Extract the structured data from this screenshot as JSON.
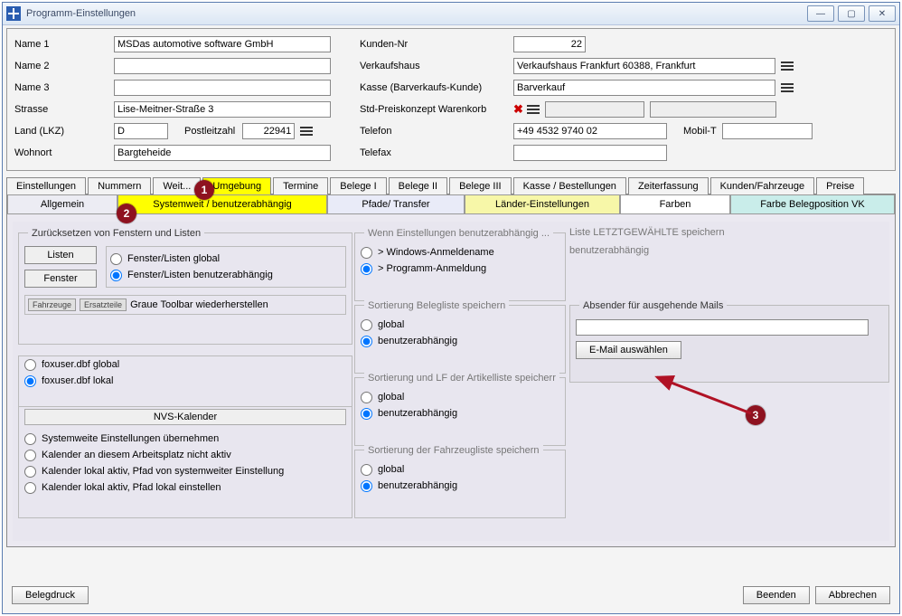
{
  "window": {
    "title": "Programm-Einstellungen"
  },
  "top": {
    "labels": {
      "name1": "Name 1",
      "name2": "Name 2",
      "name3": "Name 3",
      "street": "Strasse",
      "land": "Land (LKZ)",
      "plz": "Postleitzahl",
      "ort": "Wohnort",
      "kundennr": "Kunden-Nr",
      "verkaufshaus": "Verkaufshaus",
      "kasse": "Kasse (Barverkaufs-Kunde)",
      "pk": "Std-Preiskonzept Warenkorb",
      "tel": "Telefon",
      "mob": "Mobil-T",
      "fax": "Telefax"
    },
    "values": {
      "name1": "MSDas automotive software GmbH",
      "name2": "",
      "name3": "",
      "street": "Lise-Meitner-Straße 3",
      "land": "D",
      "plz": "22941",
      "ort": "Bargteheide",
      "kundennr": "22",
      "verkaufshaus": "Verkaufshaus Frankfurt 60388, Frankfurt",
      "kasse": "Barverkauf",
      "tel": "+49 4532 9740 02",
      "mob": "",
      "fax": ""
    }
  },
  "tabs1": [
    "Einstellungen",
    "Nummern",
    "Weit...",
    "Umgebung",
    "Termine",
    "Belege I",
    "Belege II",
    "Belege III",
    "Kasse / Bestellungen",
    "Zeiterfassung",
    "Kunden/Fahrzeuge",
    "Preise"
  ],
  "tabs1_selected": 3,
  "tabs2": [
    "Allgemein",
    "Systemweit / benutzerabhängig",
    "Pfade/ Transfer",
    "Länder-Einstellungen",
    "Farben",
    "Farbe Belegposition VK"
  ],
  "tabs2_selected": 1,
  "pane": {
    "g_reset_title": "Zurücksetzen von Fenstern und Listen",
    "btn_listen": "Listen",
    "btn_fenster": "Fenster",
    "opt_fl_global": "Fenster/Listen global",
    "opt_fl_user": "Fenster/Listen benutzerabhängig",
    "mini1": "Fahrzeuge",
    "mini2": "Ersatzteile",
    "graue": "Graue Toolbar wiederherstellen",
    "opt_fox_global": "foxuser.dbf global",
    "opt_fox_lokal": "foxuser.dbf lokal",
    "nvs_title": "NVS-Kalender",
    "nvs1": "Systemweite Einstellungen übernehmen",
    "nvs2": "Kalender an diesem Arbeitsplatz nicht aktiv",
    "nvs3": "Kalender lokal aktiv, Pfad von systemweiter Einstellung",
    "nvs4": "Kalender lokal aktiv, Pfad lokal einstellen",
    "g_einst_title": "Wenn Einstellungen benutzerabhängig ...",
    "einst_win": "> Windows-Anmeldename",
    "einst_prog": "> Programm-Anmeldung",
    "g_sort1_title": "Sortierung Belegliste speichern",
    "g_sort2_title": "Sortierung und LF der Artikelliste speicherr",
    "g_sort3_title": "Sortierung der Fahrzeugliste speichern",
    "opt_global": "global",
    "opt_user": "benutzerabhängig",
    "liste_title": "Liste LETZTGEWÄHLTE speichern",
    "liste_val": "benutzerabhängig",
    "g_mail_title": "Absender für ausgehende Mails",
    "btn_mail": "E-Mail auswählen",
    "mail_value": ""
  },
  "footer": {
    "belegdruck": "Belegdruck",
    "beenden": "Beenden",
    "abbrechen": "Abbrechen"
  },
  "annot": {
    "n1": "1",
    "n2": "2",
    "n3": "3"
  }
}
